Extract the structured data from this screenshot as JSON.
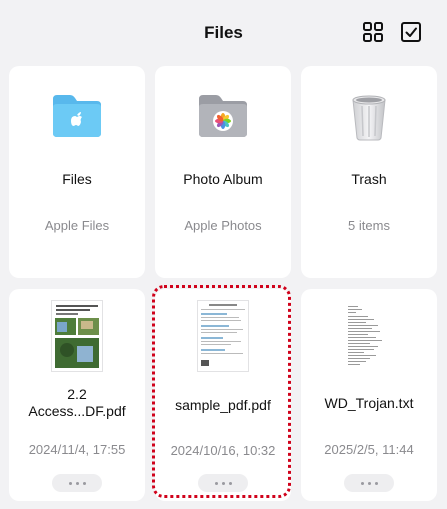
{
  "header": {
    "title": "Files",
    "grid_icon": "grid-view-icon",
    "select_icon": "checkbox-select-icon"
  },
  "locations": [
    {
      "name": "Files",
      "subtitle": "Apple Files",
      "icon": "folder-icon"
    },
    {
      "name": "Photo Album",
      "subtitle": "Apple Photos",
      "icon": "photos-folder-icon"
    },
    {
      "name": "Trash",
      "subtitle": "5 items",
      "icon": "trash-icon"
    }
  ],
  "files": [
    {
      "name": "2.2 Access...DF.pdf",
      "date": "2024/11/4, 17:55"
    },
    {
      "name": "sample_pdf.pdf",
      "date": "2024/10/16, 10:32"
    },
    {
      "name": "WD_Trojan.txt",
      "date": "2025/2/5, 11:44"
    }
  ],
  "colors": {
    "background": "#f2f2f4",
    "folder_blue": "#5ec1f0",
    "folder_gray": "#a7a9b0",
    "selection": "#d0021b"
  }
}
